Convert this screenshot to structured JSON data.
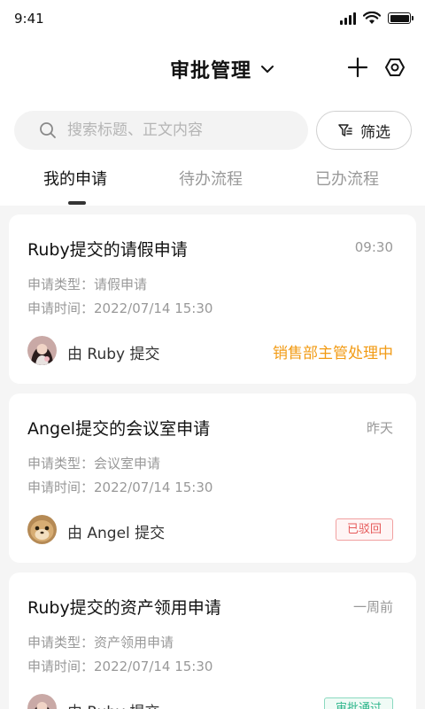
{
  "status_bar": {
    "time": "9:41"
  },
  "header": {
    "title": "审批管理"
  },
  "search": {
    "placeholder": "搜索标题、正文内容"
  },
  "filter": {
    "label": "筛选"
  },
  "tabs": [
    {
      "label": "我的申请",
      "active": true
    },
    {
      "label": "待办流程",
      "active": false
    },
    {
      "label": "已办流程",
      "active": false
    }
  ],
  "cards": [
    {
      "title": "Ruby提交的请假申请",
      "time": "09:30",
      "type_line": "申请类型：请假申请",
      "date_line": "申请时间：2022/07/14 15:30",
      "submitter": "由 Ruby 提交",
      "status": "销售部主管处理中"
    },
    {
      "title": "Angel提交的会议室申请",
      "time": "昨天",
      "type_line": "申请类型：会议室申请",
      "date_line": "申请时间：2022/07/14 15:30",
      "submitter": "由 Angel 提交",
      "status": "已驳回"
    },
    {
      "title": "Ruby提交的资产领用申请",
      "time": "一周前",
      "type_line": "申请类型：资产领用申请",
      "date_line": "申请时间：2022/07/14 15:30",
      "submitter": "由 Ruby 提交",
      "status": "审批通过"
    }
  ],
  "colors": {
    "accent_orange": "#f29b14",
    "rejected_red": "#e65a5a",
    "approved_green": "#2bb58a"
  }
}
